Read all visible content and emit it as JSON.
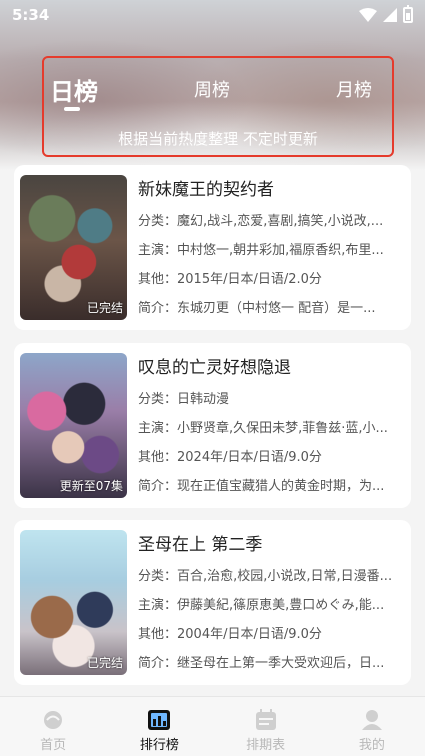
{
  "status_bar": {
    "time": "5:34"
  },
  "tabs": {
    "items": [
      {
        "label": "日榜",
        "active": true
      },
      {
        "label": "周榜",
        "active": false
      },
      {
        "label": "月榜",
        "active": false
      }
    ],
    "hint": "根据当前热度整理 不定时更新"
  },
  "list": [
    {
      "title": "新妹魔王的契约者",
      "category_label": "分类：",
      "category": "魔幻,战斗,恋爱,喜剧,搞笑,小说改,...",
      "cast_label": "主演：",
      "cast": "中村悠一,朝井彩加,福原香织,布里...",
      "other_label": "其他：",
      "other": "2015年/日本/日语/2.0分",
      "summary_label": "简介：",
      "summary": "东城刃更（中村悠一 配音）是一...",
      "badge": "已完结"
    },
    {
      "title": "叹息的亡灵好想隐退",
      "category_label": "分类：",
      "category": "日韩动漫",
      "cast_label": "主演：",
      "cast": "小野贤章,久保田未梦,菲鲁兹·蓝,小...",
      "other_label": "其他：",
      "other": "2024年/日本/日语/9.0分",
      "summary_label": "简介：",
      "summary": "现在正值宝藏猎人的黄金时期，为...",
      "badge": "更新至07集"
    },
    {
      "title": "圣母在上 第二季",
      "category_label": "分类：",
      "category": "百合,治愈,校园,小说改,日常,日漫番...",
      "cast_label": "主演：",
      "cast": "伊藤美紀,篠原恵美,豊口めぐみ,能...",
      "other_label": "其他：",
      "other": "2004年/日本/日语/9.0分",
      "summary_label": "简介：",
      "summary": "继圣母在上第一季大受欢迎后，日...",
      "badge": "已完结"
    }
  ],
  "bottom_nav": [
    {
      "label": "首页",
      "icon": "home-icon",
      "active": false
    },
    {
      "label": "排行榜",
      "icon": "ranking-icon",
      "active": true
    },
    {
      "label": "排期表",
      "icon": "calendar-icon",
      "active": false
    },
    {
      "label": "我的",
      "icon": "profile-icon",
      "active": false
    }
  ]
}
